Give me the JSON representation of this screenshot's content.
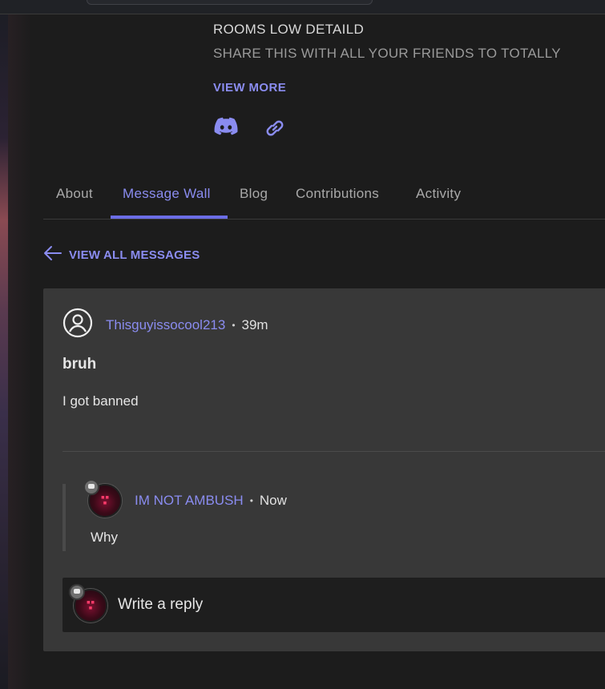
{
  "header": {
    "description_line1": "ROOMS LOW DETAILD",
    "description_line2": "SHARE THIS WITH ALL YOUR FRIENDS TO TOTALLY",
    "view_more_label": "VIEW MORE",
    "social_icons": [
      "discord-icon",
      "link-icon"
    ]
  },
  "tabs": [
    {
      "label": "About",
      "active": false
    },
    {
      "label": "Message Wall",
      "active": true
    },
    {
      "label": "Blog",
      "active": false
    },
    {
      "label": "Contributions",
      "active": false
    },
    {
      "label": "Activity",
      "active": false
    }
  ],
  "back_link": {
    "label": "VIEW ALL MESSAGES",
    "icon": "arrow-left-icon"
  },
  "thread": {
    "author": "Thisguyissocool213",
    "time": "39m",
    "title": "bruh",
    "body": "I got banned",
    "replies": [
      {
        "author": "IM NOT AMBUSH",
        "time": "Now",
        "body": "Why"
      }
    ],
    "reply_placeholder": "Write a reply"
  },
  "colors": {
    "accent": "#8a8cf0",
    "tab_underline": "#6b6de6",
    "card_bg": "#383838",
    "page_bg": "#1c1c1c"
  }
}
